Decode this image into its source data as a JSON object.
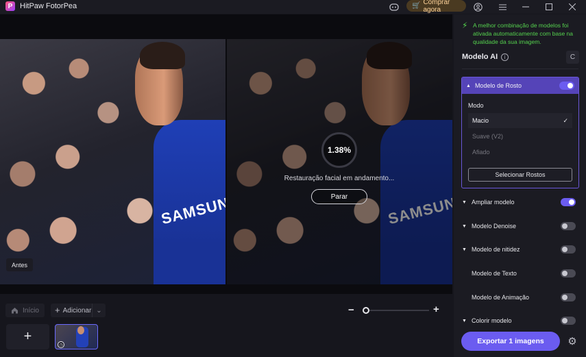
{
  "app": {
    "title": "HitPaw FotorPea",
    "logo_letter": "P"
  },
  "titlebar": {
    "buy_label": "Comprar agora",
    "icons": [
      "discord-icon",
      "cart-icon",
      "account-icon",
      "menu-icon",
      "minimize-icon",
      "maximize-icon",
      "close-icon"
    ]
  },
  "preview": {
    "before_label": "Antes",
    "jersey_text": "SAMSUNG",
    "progress_percent": "1.38%",
    "progress_text": "Restauração facial em andamento...",
    "stop_label": "Parar"
  },
  "bottombar": {
    "home_label": "Início",
    "add_label": "Adicionar"
  },
  "panel": {
    "notice": "A melhor combinação de modelos foi ativada automaticamente com base na qualidade da sua imagem.",
    "section_title": "Modelo AI",
    "face_model": {
      "label": "Modelo de Rosto",
      "enabled": true,
      "mode_label": "Modo",
      "modes": [
        {
          "label": "Macio",
          "selected": true
        },
        {
          "label": "Suave (V2)",
          "selected": false
        },
        {
          "label": "Afiado",
          "selected": false
        }
      ],
      "select_faces_label": "Selecionar Rostos"
    },
    "models": [
      {
        "label": "Ampliar modelo",
        "expandable": true,
        "enabled": true
      },
      {
        "label": "Modelo Denoise",
        "expandable": true,
        "enabled": false
      },
      {
        "label": "Modelo de nitidez",
        "expandable": true,
        "enabled": false
      },
      {
        "label": "Modelo de Texto",
        "expandable": false,
        "enabled": false
      },
      {
        "label": "Modelo de Animação",
        "expandable": false,
        "enabled": false
      },
      {
        "label": "Colorir modelo",
        "expandable": true,
        "enabled": false
      }
    ],
    "export_label": "Exportar 1 imagens"
  },
  "colors": {
    "accent": "#6b5cf0",
    "notice_green": "#55d24e",
    "buy_text": "#ffd39a"
  }
}
